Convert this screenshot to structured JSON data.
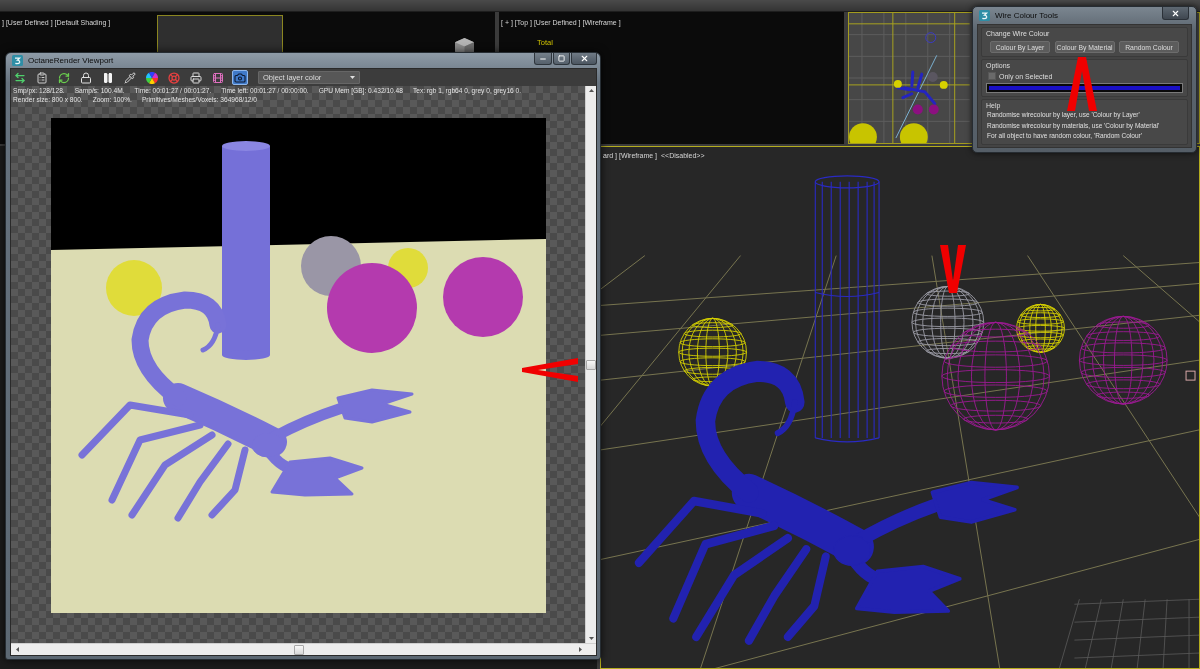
{
  "viewports": {
    "shaded": {
      "label": "] [User Defined ] [Default Shading ]"
    },
    "top": {
      "label": "[ + ] [Top ] [User Defined ] [Wireframe ]",
      "stat_heading": "Total"
    },
    "perspective": {
      "label": "ard ] [Wireframe ]  <<Disabled>>"
    }
  },
  "octane_window": {
    "title": "OctaneRender Viewport",
    "toolbar_buttons": [
      {
        "selected": false
      },
      {
        "selected": false
      },
      {
        "selected": false
      },
      {
        "selected": false
      },
      {
        "selected": false
      },
      {
        "selected": false
      },
      {
        "selected": false
      },
      {
        "selected": false
      },
      {
        "selected": false
      },
      {
        "selected": false
      },
      {
        "selected": true
      }
    ],
    "display_mode": "Object layer color",
    "stats": [
      [
        "Smp/px: 128/128.",
        "Samp/s: 100.4M.",
        "Time: 00:01:27 / 00:01:27.",
        "Time left: 00:01:27 / 00:00:00.",
        "GPU Mem [GB]: 0.432/10.48",
        "Tex: rgb 1, rgb64 0, grey 0, grey16 0."
      ],
      [
        "Render size: 800 x 800.",
        "Zoom: 100%.",
        "Primitives/Meshes/Voxels: 364968/12/0"
      ]
    ]
  },
  "wire_colour_tools": {
    "title": "Wire Colour Tools",
    "change_group": {
      "heading": "Change Wire Colour",
      "buttons": [
        "Colour By Layer",
        "Colour By Material",
        "Random Colour"
      ]
    },
    "options_group": {
      "heading": "Options",
      "only_selected": {
        "label": "Only on Selected",
        "checked": false
      },
      "progress": {
        "level": 1
      }
    },
    "help_group": {
      "heading": "Help",
      "lines": [
        "Randomise wirecolour by layer, use 'Colour by Layer'",
        "Randomise wirecolour by materials, use 'Colour by Material'",
        "For all object to have random colour, 'Random Colour'"
      ]
    }
  }
}
